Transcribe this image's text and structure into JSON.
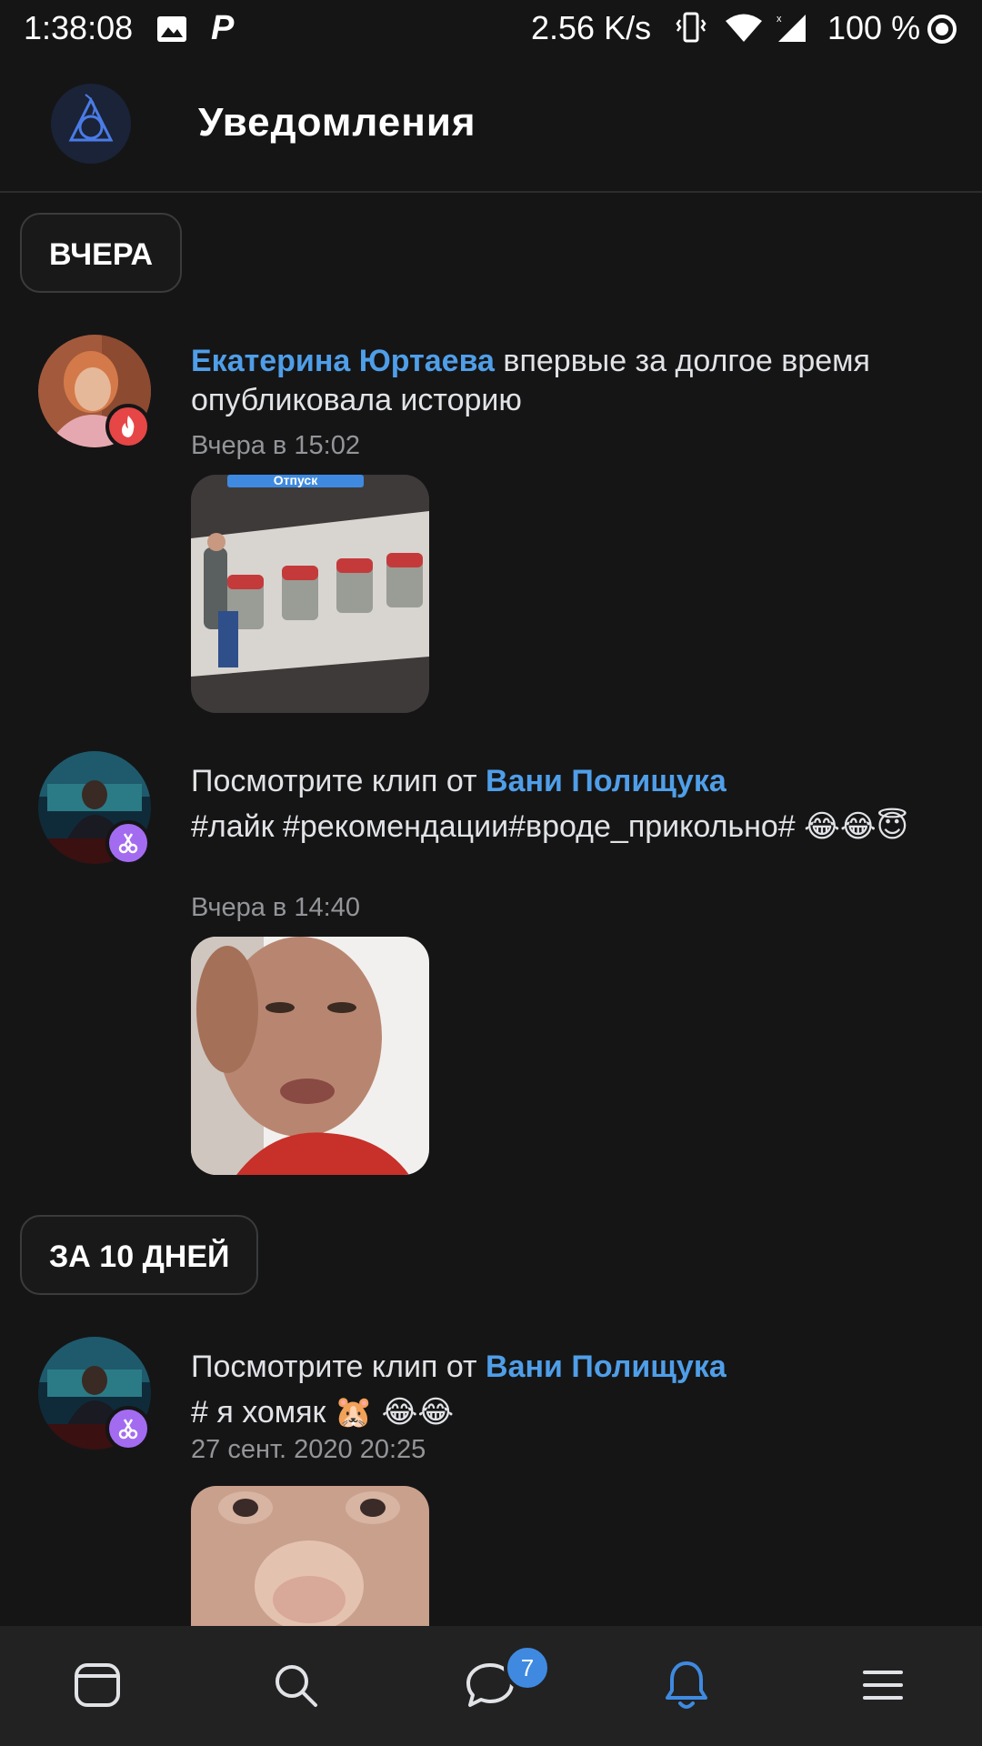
{
  "status_bar": {
    "time": "1:38:08",
    "speed": "2.56 K/s",
    "battery": "100 %",
    "icons": [
      "gallery-icon",
      "p-app-icon",
      "vibrate-icon",
      "wifi-icon",
      "cell-signal-icon",
      "ring-icon"
    ]
  },
  "header": {
    "title": "Уведомления",
    "logo_icon": "community-logo-icon"
  },
  "sections": {
    "yesterday": "ВЧЕРА",
    "ten_days": "ЗА 10 ДНЕЙ"
  },
  "notifications": [
    {
      "name": "Екатерина Юртаева",
      "text": " впервые за долгое время опубликовала историю",
      "time": "Вчера в 15:02",
      "badge_icon": "fire-icon",
      "badge_color": "#e64646",
      "thumb_caption": "Отпуск"
    },
    {
      "prefix": "Посмотрите клип от ",
      "name": "Вани Полищука",
      "text": "#лайк #рекомендации#вроде_прикольно# 😂😂😇",
      "time": "Вчера в 14:40",
      "badge_icon": "clip-icon",
      "badge_color": "#a36cf0"
    },
    {
      "prefix": "Посмотрите клип от ",
      "name": "Вани Полищука",
      "text": "# я хомяк 🐹 😂😂",
      "time": "27 сент. 2020 20:25",
      "badge_icon": "clip-icon",
      "badge_color": "#a36cf0"
    }
  ],
  "bottom_nav": {
    "items": [
      "feed-icon",
      "search-icon",
      "messages-icon",
      "notifications-bell-icon",
      "menu-icon"
    ],
    "messages_badge": "7",
    "active_color": "#3f8ae0"
  }
}
